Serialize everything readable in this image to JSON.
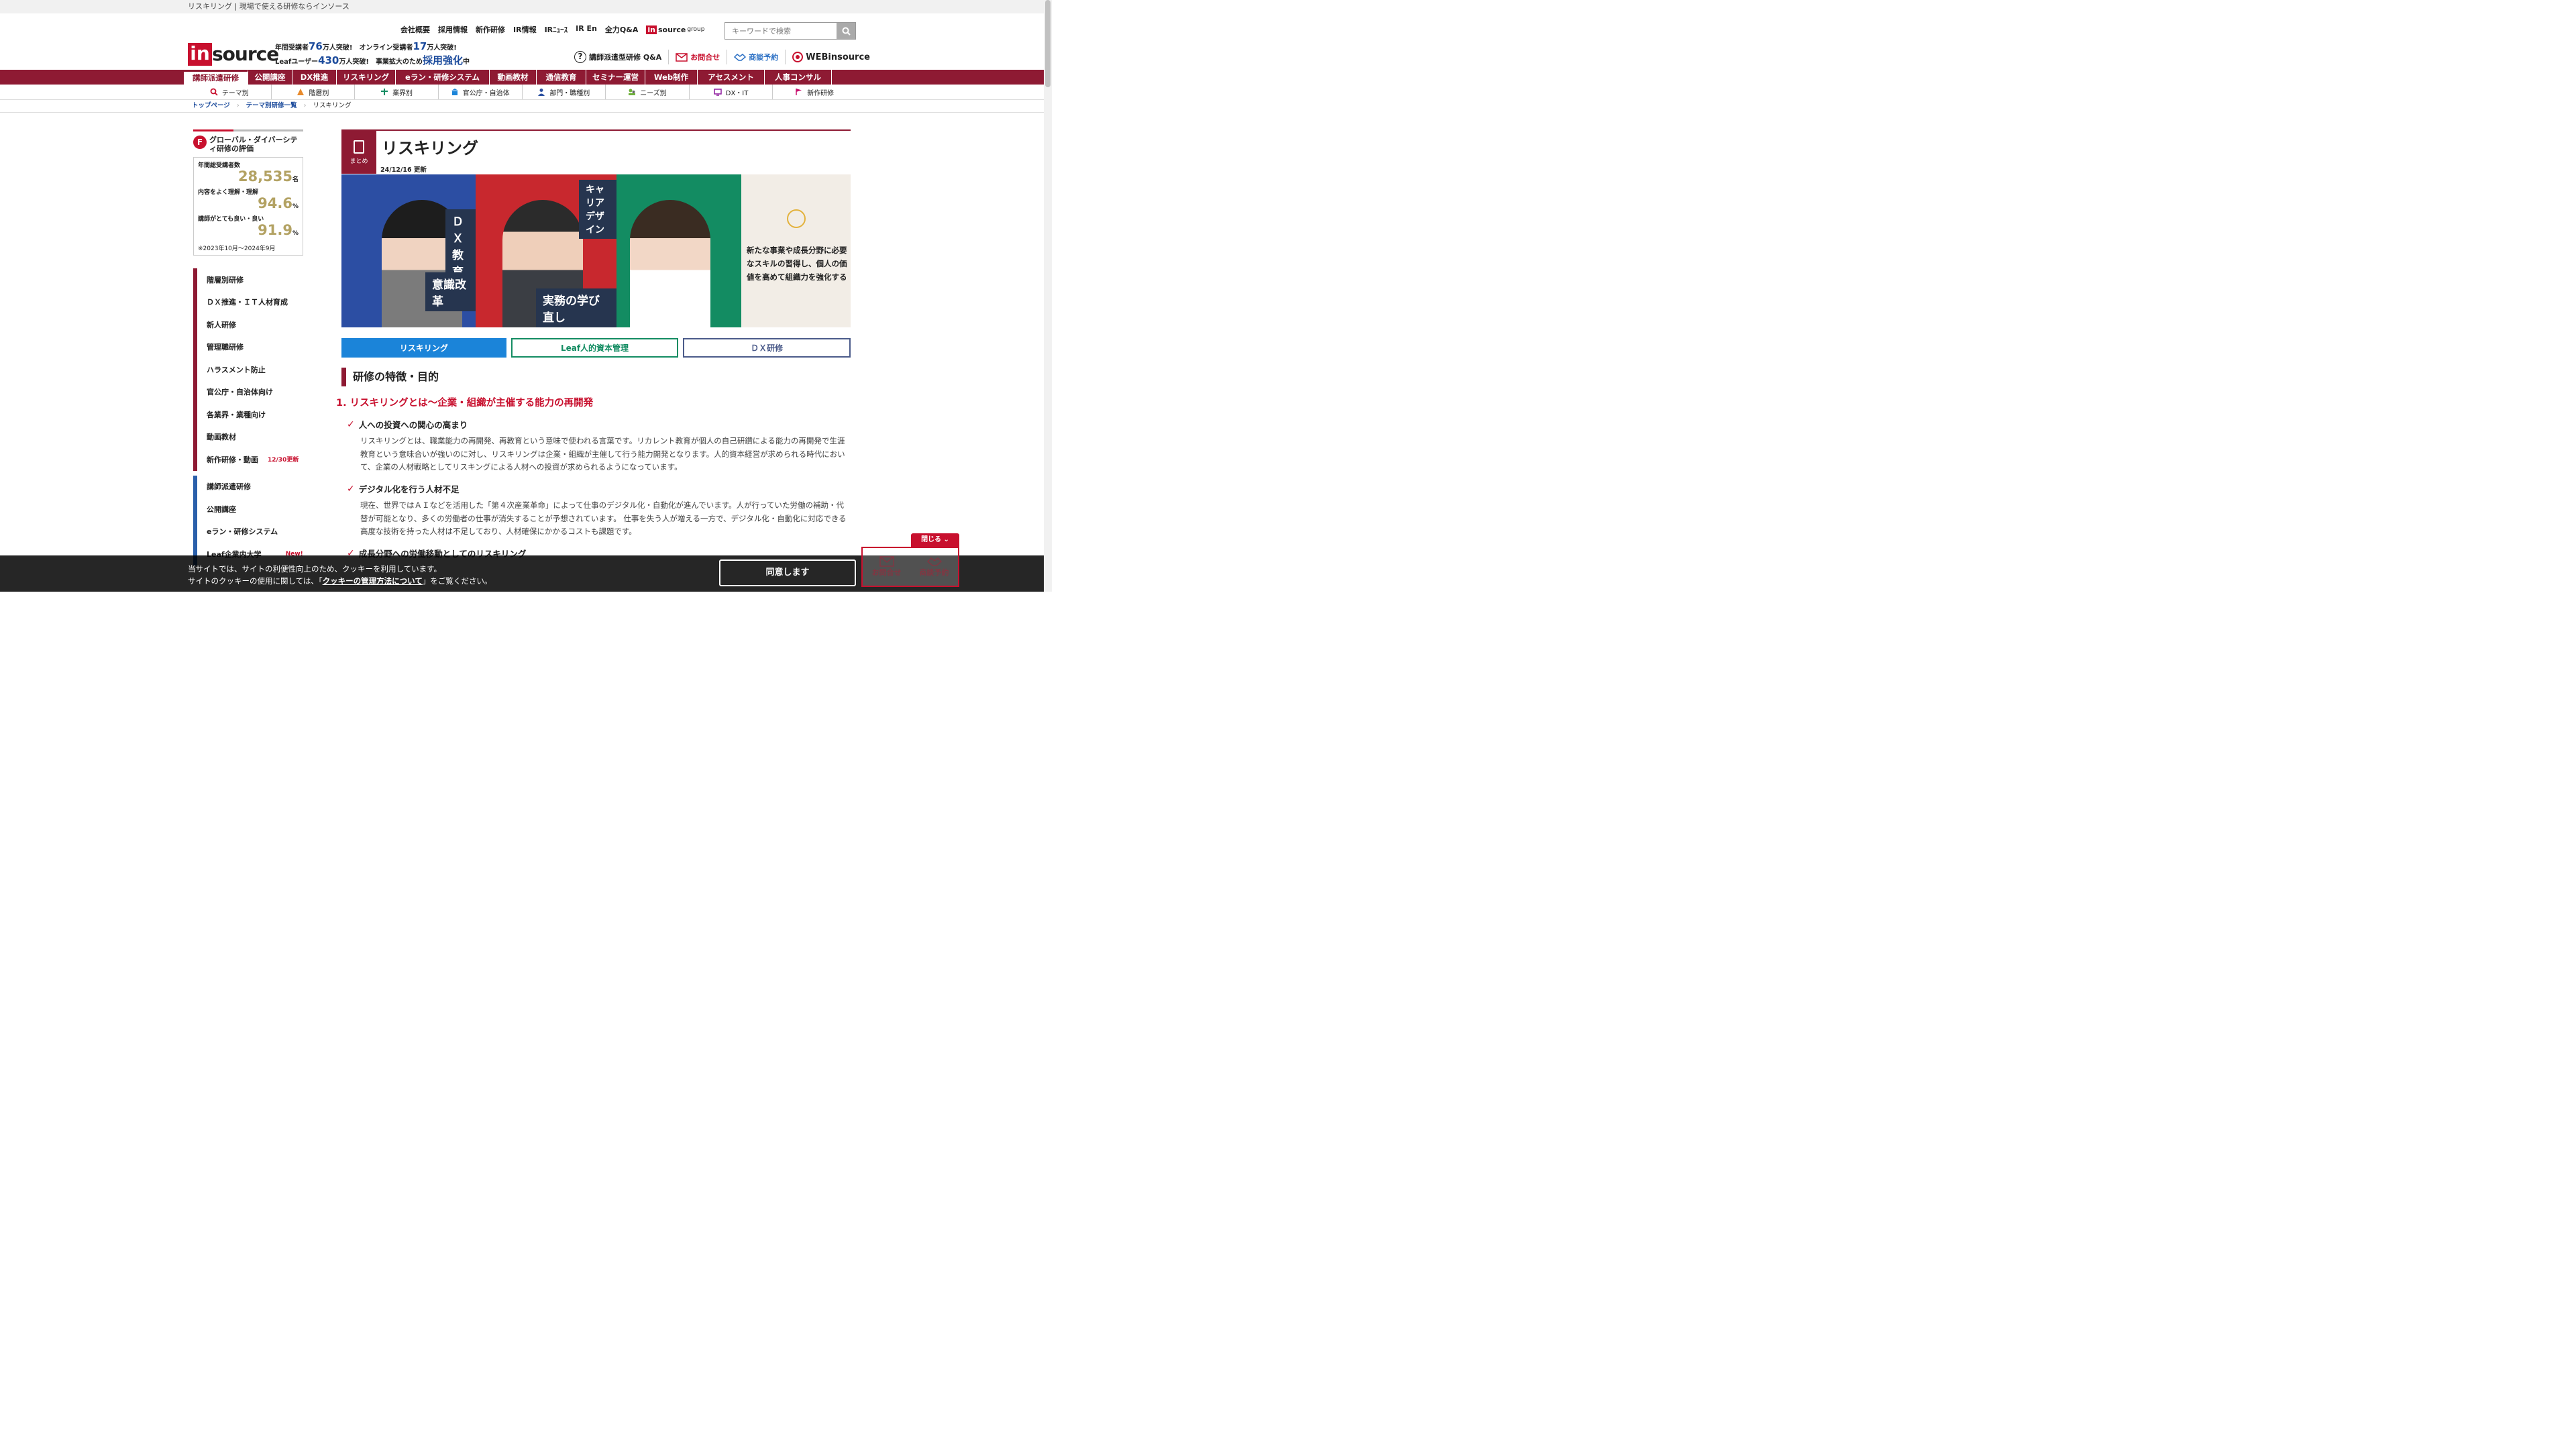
{
  "page_title": "リスキリング | 現場で使える研修ならインソース",
  "logo": {
    "i": "in",
    "rest": "source"
  },
  "stats": {
    "l1a": "年間受講者",
    "l1n": "76",
    "l1b": "万人突破!",
    "l1c": "オンライン受講者",
    "l1n2": "17",
    "l1d": "万人突破!",
    "l2a": "Leafユーザー",
    "l2n": "430",
    "l2b": "万人突破!",
    "l2c": "事業拡大のため",
    "l2n2": "採用強化",
    "l2d": "中"
  },
  "top_nav": [
    "会社概要",
    "採用情報",
    "新作研修",
    "IR情報",
    "IRﾆｭｰｽ",
    "IR En",
    "全力Q&A"
  ],
  "group": {
    "box": "in",
    "text": "source",
    "small": "group"
  },
  "search": {
    "placeholder": "キーワードで検索"
  },
  "utility": {
    "qa": "講師派遣型研修 Q&A",
    "contact": "お問合せ",
    "meeting": "商談予約",
    "webinsource": "WEBinsource"
  },
  "main_nav": [
    {
      "label": "講師派遣研修",
      "w": 96
    },
    {
      "label": "公開講座",
      "w": 66
    },
    {
      "label": "DX推進",
      "w": 66
    },
    {
      "label": "リスキリング",
      "w": 88
    },
    {
      "label": "eラン・研修システム",
      "w": 140
    },
    {
      "label": "動画教材",
      "w": 70
    },
    {
      "label": "通信教育",
      "w": 74
    },
    {
      "label": "セミナー運営",
      "w": 88
    },
    {
      "label": "Web制作",
      "w": 78
    },
    {
      "label": "アセスメント",
      "w": 100
    },
    {
      "label": "人事コンサル",
      "w": 100
    }
  ],
  "sub_nav": [
    "テーマ別",
    "階層別",
    "業界別",
    "官公庁・自治体",
    "部門・職種別",
    "ニーズ別",
    "DX・IT",
    "新作研修"
  ],
  "breadcrumb": [
    "トップページ",
    "テーマ別研修一覧",
    "リスキリング"
  ],
  "evaluation": {
    "badge": "F",
    "title": "グローバル・ダイバーシティ研修の評価",
    "k1": "年間総受講者数",
    "v1": "28,535",
    "u1": "名",
    "k2": "内容をよく理解・理解",
    "v2": "94.6",
    "u2": "%",
    "k3": "講師がとても良い・良い",
    "v3": "91.9",
    "u3": "%",
    "note": "※2023年10月～2024年9月"
  },
  "side_menu_1": [
    "階層別研修",
    "ＤＸ推進・ＩＴ人材育成",
    "新人研修",
    "管理職研修",
    "ハラスメント防止",
    "官公庁・自治体向け",
    "各業界・業種向け",
    "動画教材"
  ],
  "side_menu_new": {
    "label": "新作研修・動画",
    "tag": "12/30更新"
  },
  "side_menu_2": [
    "講師派遣研修",
    "公開講座",
    "eラン・研修システム"
  ],
  "side_menu_leaf": {
    "label": "Leaf企業内大学",
    "tag": "New!"
  },
  "article": {
    "badge": "まとめ",
    "title": "リスキリング",
    "date": "24/12/16 更新",
    "hero_tags": {
      "dx": "ＤＸ教育",
      "career": "キャリアデザイン",
      "mind": "意識改革",
      "relearn": "実務の学び直し"
    },
    "hero_side": "新たな事業や成長分野に必要なスキルの習得し、個人の価値を高めて組織力を強化する",
    "tabs": [
      "リスキリング",
      "Leaf人的資本管理",
      "ＤＸ研修"
    ],
    "section_title": "研修の特徴・目的",
    "h3": "1. リスキリングとは～企業・組織が主催する能力の再開発",
    "items": [
      {
        "heading": "人への投資への関心の高まり",
        "body": "リスキリングとは、職業能力の再開発、再教育という意味で使われる言葉です。リカレント教育が個人の自己研鑽による能力の再開発で生涯教育という意味合いが強いのに対し、リスキリングは企業・組織が主催して行う能力開発となります。人的資本経営が求められる時代において、企業の人材戦略としてリスキングによる人材への投資が求められるようになっています。"
      },
      {
        "heading": "デジタル化を行う人材不足",
        "body": "現在、世界ではＡＩなどを活用した「第４次産業革命」によって仕事のデジタル化・自動化が進んでいます。人が行っていた労働の補助・代替が可能となり、多くの労働者の仕事が消失することが予想されています。 仕事を失う人が増える一方で、デジタル化・自動化に対応できる高度な技術を持った人材は不足しており、人材確保にかかるコストも課題です。"
      },
      {
        "heading": "成長分野への労働移動としてのリスキリング",
        "body": ""
      }
    ]
  },
  "cookie": {
    "line1": "当サイトでは、サイトの利便性向上のため、クッキーを利用しています。",
    "line2a": "サイトのクッキーの使用に関しては、「",
    "link": "クッキーの管理方法について",
    "line2b": "」をご覧ください。",
    "agree": "同意します"
  },
  "float": {
    "close": "閉じる",
    "contact": "お問合せ",
    "meeting": "商談予約"
  }
}
